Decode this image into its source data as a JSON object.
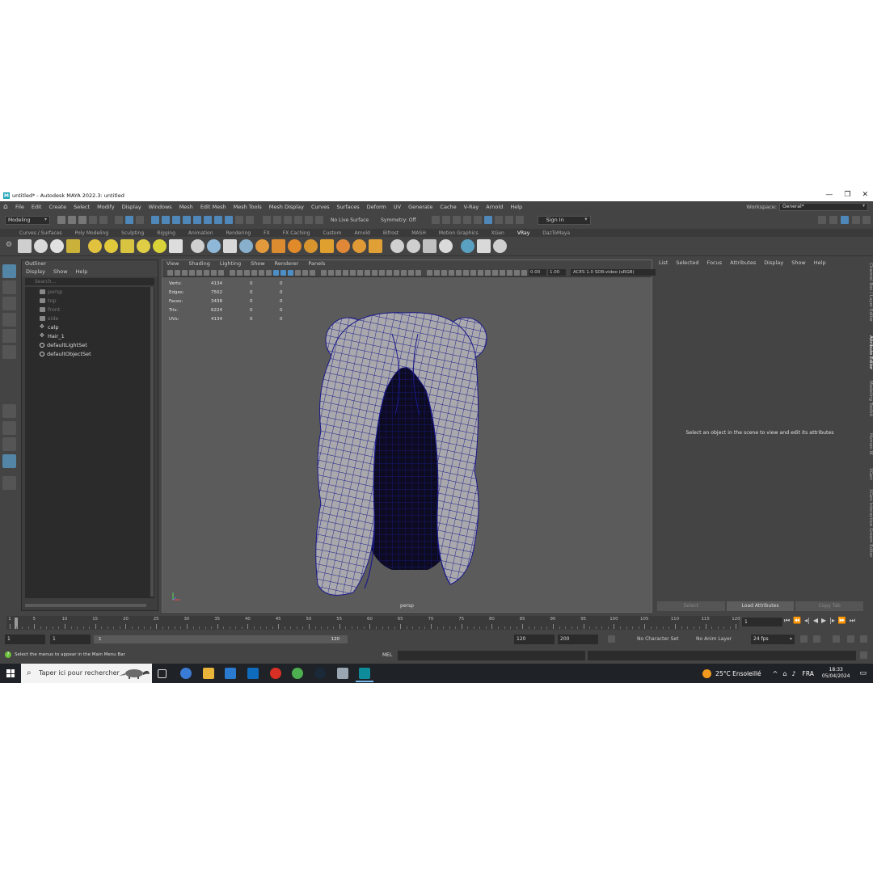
{
  "window": {
    "title": "untitled* - Autodesk MAYA 2022.3: untitled",
    "controls": [
      "—",
      "❐",
      "✕"
    ]
  },
  "menubar": {
    "items": [
      "File",
      "Edit",
      "Create",
      "Select",
      "Modify",
      "Display",
      "Windows",
      "Mesh",
      "Edit Mesh",
      "Mesh Tools",
      "Mesh Display",
      "Curves",
      "Surfaces",
      "Deform",
      "UV",
      "Generate",
      "Cache",
      "V-Ray",
      "Arnold",
      "Help"
    ],
    "workspace_label": "Workspace:",
    "workspace_value": "General*"
  },
  "statusline": {
    "mode": "Modeling",
    "live_surface": "No Live Surface",
    "symmetry": "Symmetry: Off",
    "sign_in": "Sign In"
  },
  "shelf": {
    "tabs": [
      "Curves / Surfaces",
      "Poly Modeling",
      "Sculpting",
      "Rigging",
      "Animation",
      "Rendering",
      "FX",
      "FX Caching",
      "Custom",
      "Arnold",
      "Bifrost",
      "MASH",
      "Motion Graphics",
      "XGen",
      "VRay",
      "DazToMaya"
    ],
    "active_tab": "VRay",
    "icon_colors": [
      "#cfcfcf",
      "#d9d9d9",
      "#e0e0e0",
      "#c9b13a",
      "#e0c23e",
      "#e2c93c",
      "#d8c440",
      "#e0cd46",
      "#d9d238",
      "#dddddd",
      "#d0d0d0",
      "#8fb8d8",
      "#d8d8d8",
      "#88b0cc",
      "#e39a3c",
      "#dc8c30",
      "#e08a2a",
      "#d8952e",
      "#e0a030",
      "#e08838",
      "#e09a35",
      "#e0a035",
      "#d0d0d0",
      "#cfcfcf",
      "#c0c0c0",
      "#dadada",
      "#5aa0c0",
      "#d9d9d9",
      "#cfcfcf"
    ]
  },
  "outliner": {
    "title": "Outliner",
    "menu": [
      "Display",
      "Show",
      "Help"
    ],
    "search_placeholder": "Search...",
    "items": [
      {
        "label": "persp",
        "icon": "camera-icon",
        "dim": true
      },
      {
        "label": "top",
        "icon": "camera-icon",
        "dim": true
      },
      {
        "label": "front",
        "icon": "camera-icon",
        "dim": true
      },
      {
        "label": "side",
        "icon": "camera-icon",
        "dim": true
      },
      {
        "label": "calp",
        "icon": "group-icon",
        "dim": false
      },
      {
        "label": "Hair_1",
        "icon": "group-icon",
        "dim": false
      },
      {
        "label": "defaultLightSet",
        "icon": "set-icon",
        "dim": false
      },
      {
        "label": "defaultObjectSet",
        "icon": "set-icon",
        "dim": false
      }
    ]
  },
  "viewport": {
    "menu": [
      "View",
      "Shading",
      "Lighting",
      "Show",
      "Renderer",
      "Panels"
    ],
    "exposure": "0.00",
    "gamma": "1.00",
    "color_space": "ACES 1.0 SDR-video (sRGB)",
    "camera": "persp",
    "hud": [
      {
        "label": "Verts:",
        "values": [
          "4134",
          "0",
          "0"
        ]
      },
      {
        "label": "Edges:",
        "values": [
          "7502",
          "0",
          "0"
        ]
      },
      {
        "label": "Faces:",
        "values": [
          "3438",
          "0",
          "0"
        ]
      },
      {
        "label": "Tris:",
        "values": [
          "6224",
          "0",
          "0"
        ]
      },
      {
        "label": "UVs:",
        "values": [
          "4134",
          "0",
          "0"
        ]
      }
    ],
    "background": "#5b5b5b",
    "wire_color": "#1c1a8a",
    "mesh_color": "#a9a9ad"
  },
  "attribute_editor": {
    "menu": [
      "List",
      "Selected",
      "Focus",
      "Attributes",
      "Display",
      "Show",
      "Help"
    ],
    "message": "Select an object in the scene to view and edit its attributes",
    "buttons": [
      "Select",
      "Load Attributes",
      "Copy Tab"
    ],
    "side_tabs": [
      "Channel Box / Layer Editor",
      "Attribute Editor",
      "Modeling Toolkit",
      "Human IK",
      "XGen",
      "XGen Interactive Groom Editor"
    ]
  },
  "timeline": {
    "ticks": [
      "1",
      "5",
      "10",
      "15",
      "20",
      "25",
      "30",
      "35",
      "40",
      "45",
      "50",
      "55",
      "60",
      "65",
      "70",
      "75",
      "80",
      "85",
      "90",
      "95",
      "100",
      "105",
      "110",
      "115",
      "120"
    ],
    "current_frame": "1",
    "playback_controls": [
      "⏮",
      "⏪",
      "◂|",
      "◀",
      "▶",
      "|▸",
      "⏩",
      "⏭"
    ]
  },
  "range": {
    "start": "1",
    "playback_start": "1",
    "range_start_label": "1",
    "range_end_label": "120",
    "playback_end": "120",
    "end": "200",
    "character_set": "No Character Set",
    "anim_layer": "No Anim Layer",
    "fps": "24 fps"
  },
  "commandline": {
    "help_text": "Select the menus to appear in the Main Menu Bar",
    "mel_label": "MEL"
  },
  "taskbar": {
    "search_placeholder": "Taper ici pour rechercher",
    "weather": "25°C Ensoleillé",
    "language": "FRA",
    "time": "18:33",
    "date": "05/04/2024",
    "app_colors": [
      "#3a7bd5",
      "#e8b43a",
      "#2a7bd0",
      "#0f6cbd",
      "#d93025",
      "#4caf50",
      "#1b2838",
      "#9aa7b3",
      "#0e8c9c"
    ]
  }
}
